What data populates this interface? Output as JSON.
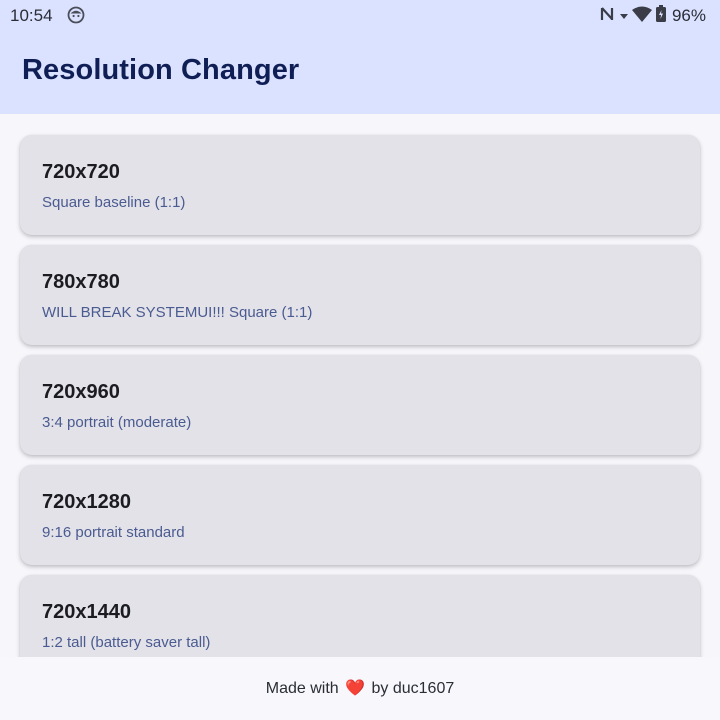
{
  "status_bar": {
    "time": "10:54",
    "battery": "96%",
    "icons": [
      "face-icon",
      "nfc-icon",
      "wifi-icon",
      "battery-icon"
    ]
  },
  "app": {
    "title": "Resolution Changer"
  },
  "resolutions": [
    {
      "title": "720x720",
      "subtitle": "Square baseline (1:1)"
    },
    {
      "title": "780x780",
      "subtitle": "WILL BREAK SYSTEMUI!!! Square (1:1)"
    },
    {
      "title": "720x960",
      "subtitle": "3:4 portrait (moderate)"
    },
    {
      "title": "720x1280",
      "subtitle": "9:16 portrait standard"
    },
    {
      "title": "720x1440",
      "subtitle": "1:2 tall (battery saver tall)"
    }
  ],
  "footer": {
    "prefix": "Made with",
    "heart": "❤️",
    "suffix": "by duc1607"
  },
  "colors": {
    "header_bg": "#dbe2ff",
    "title": "#0f1e55",
    "card_bg": "#e3e2e8",
    "subtitle": "#4a5b91"
  }
}
